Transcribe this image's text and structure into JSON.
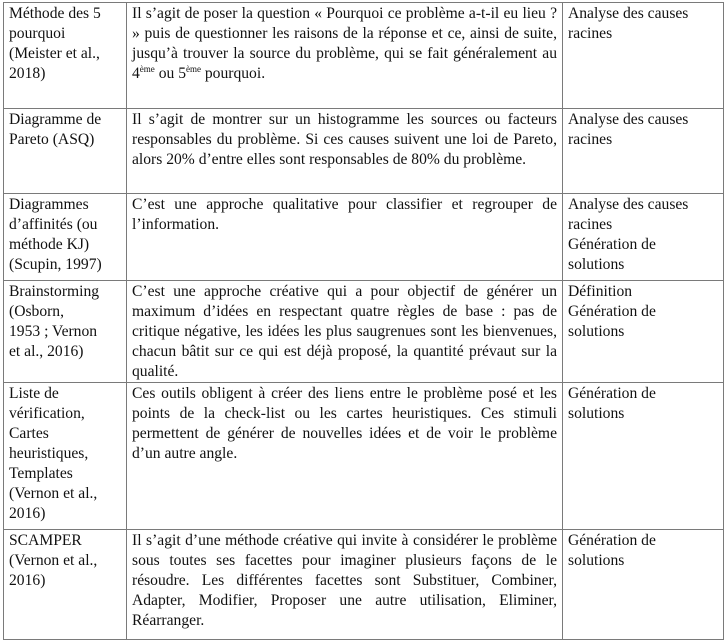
{
  "table": {
    "rows": [
      {
        "method": [
          "Méthode des 5",
          "pourquoi",
          "(Meister et al.,",
          "2018)"
        ],
        "description_before": "Il s’agit de poser la question « Pourquoi ce problème a-t-il eu lieu ? » puis de questionner les raisons de la réponse et ce, ainsi de suite, jusqu’à trouver la source du problème, qui se fait généralement au 4",
        "sup1": "ème",
        "description_mid": " ou 5",
        "sup2": "ème",
        "description_after": " pourquoi.",
        "usage": [
          "Analyse des causes",
          "racines"
        ]
      },
      {
        "method": [
          "Diagramme de",
          "Pareto (ASQ)"
        ],
        "description": "Il s’agit de montrer sur un histogramme les sources ou facteurs responsables du problème. Si ces causes suivent une loi de Pareto, alors 20% d’entre elles sont responsables de 80% du problème.",
        "usage": [
          "Analyse des causes",
          "racines"
        ]
      },
      {
        "method": [
          "Diagrammes",
          "d’affinités (ou",
          "méthode KJ)",
          "(Scupin, 1997)"
        ],
        "description": "C’est une approche qualitative pour classifier et regrouper de l’information.",
        "usage": [
          "Analyse des causes",
          "racines",
          "Génération de",
          "solutions"
        ]
      },
      {
        "method": [
          "Brainstorming",
          "(Osborn,",
          "1953 ; Vernon",
          "et al., 2016)"
        ],
        "description": "C’est une approche créative qui a pour objectif de générer un maximum d’idées en respectant quatre règles de base : pas de critique négative, les idées les plus saugrenues sont les bienvenues, chacun bâtit sur ce qui est déjà proposé, la quantité prévaut sur la qualité.",
        "usage": [
          "Définition",
          "Génération de",
          "solutions"
        ]
      },
      {
        "method": [
          "Liste de",
          "vérification,",
          "Cartes",
          "heuristiques,",
          "Templates",
          "(Vernon et al.,",
          "2016)"
        ],
        "description": "Ces outils obligent à créer des liens entre le problème posé et les points de la check-list ou les cartes heuristiques. Ces stimuli permettent de générer de nouvelles idées et de voir le problème d’un autre angle.",
        "usage": [
          "Génération de",
          "solutions"
        ]
      },
      {
        "method": [
          "SCAMPER",
          "(Vernon et al.,",
          "2016)"
        ],
        "description": "Il s’agit d’une méthode créative qui invite à considérer le problème sous toutes ses facettes pour imaginer plusieurs façons de le résoudre. Les différentes facettes sont Substituer, Combiner, Adapter, Modifier, Proposer une autre utilisation, Eliminer, Réarranger.",
        "usage": [
          "Génération de",
          "solutions"
        ]
      }
    ]
  }
}
